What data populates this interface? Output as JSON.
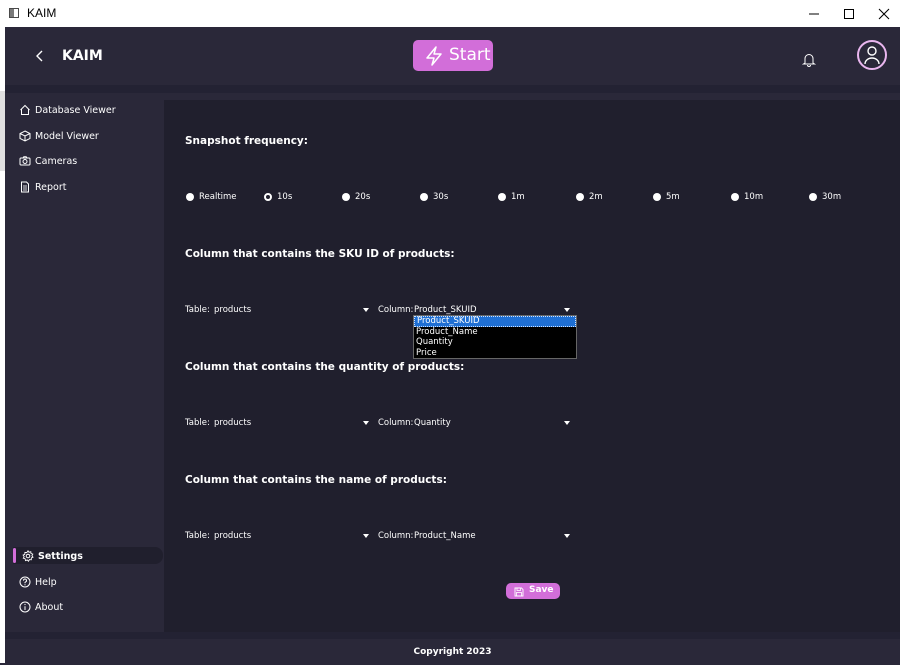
{
  "os": {
    "title": "KAIM"
  },
  "header": {
    "brand": "KAIM",
    "start_label": "Start"
  },
  "sidebar": {
    "items": [
      {
        "label": "Database Viewer",
        "icon": "home-icon"
      },
      {
        "label": "Model Viewer",
        "icon": "cube-icon"
      },
      {
        "label": "Cameras",
        "icon": "camera-icon"
      },
      {
        "label": "Report",
        "icon": "document-icon"
      }
    ],
    "bottom": [
      {
        "label": "Settings",
        "icon": "gear-icon",
        "active": true
      },
      {
        "label": "Help",
        "icon": "help-icon"
      },
      {
        "label": "About",
        "icon": "info-icon"
      }
    ]
  },
  "settings": {
    "snapshot_heading": "Snapshot frequency:",
    "frequencies": [
      "Realtime",
      "10s",
      "20s",
      "30s",
      "1m",
      "2m",
      "5m",
      "10m",
      "30m"
    ],
    "selected_frequency": "10s",
    "sku_heading": "Column that contains the SKU ID of products:",
    "quantity_heading": "Column that contains the quantity of products:",
    "name_heading": "Column that contains the name of products:",
    "table_label": "Table:",
    "column_label": "Column:",
    "sku": {
      "table": "products",
      "column": "Product_SKUID"
    },
    "quantity": {
      "table": "products",
      "column": "Quantity"
    },
    "name": {
      "table": "products",
      "column": "Product_Name"
    },
    "dropdown_options": [
      "Product_SKUID",
      "Product_Name",
      "Quantity",
      "Price"
    ],
    "dropdown_highlighted": "Product_SKUID",
    "save_label": "Save"
  },
  "footer": {
    "copyright": "Copyright 2023"
  },
  "colors": {
    "accent": "#d26ed9",
    "bg": "#2a2839",
    "panel": "#201f2d",
    "highlight": "#1f6fd3"
  }
}
